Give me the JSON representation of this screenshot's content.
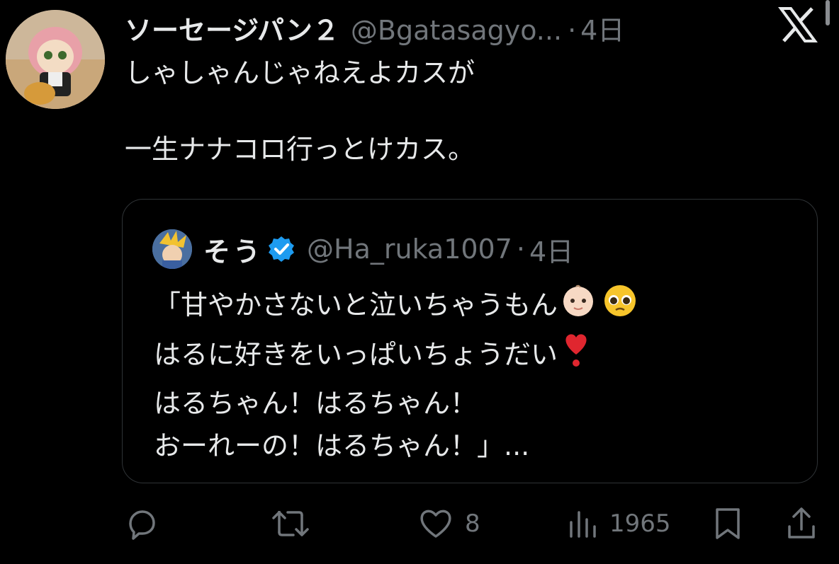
{
  "tweet": {
    "display_name": "ソーセージパン２",
    "handle": "@Bgatasagyo...",
    "separator": "·",
    "time": "4日",
    "text_lines": [
      "しゃしゃんじゃねえよカスが",
      "一生ナナコロ行っとけカス。"
    ]
  },
  "quote": {
    "display_name": "そう",
    "handle": "@Ha_ruka1007",
    "separator": "·",
    "time": "4日",
    "lines": [
      "「甘やかさないと泣いちゃうもん",
      "はるに好きをいっぱいちょうだい",
      "はるちゃん！はるちゃん！",
      "おーれーの！はるちゃん！」..."
    ]
  },
  "actions": {
    "reply_count": "",
    "retweet_count": "",
    "like_count": "8",
    "view_count": "1965"
  },
  "icons": {
    "logo": "x-logo-icon",
    "verified": "verified-badge-icon",
    "reply": "reply-icon",
    "retweet": "retweet-icon",
    "like": "heart-icon",
    "views": "views-icon",
    "bookmark": "bookmark-icon",
    "share": "share-icon"
  },
  "colors": {
    "verified": "#1d9bf0",
    "muted": "#71767b",
    "text": "#e7e9ea"
  }
}
